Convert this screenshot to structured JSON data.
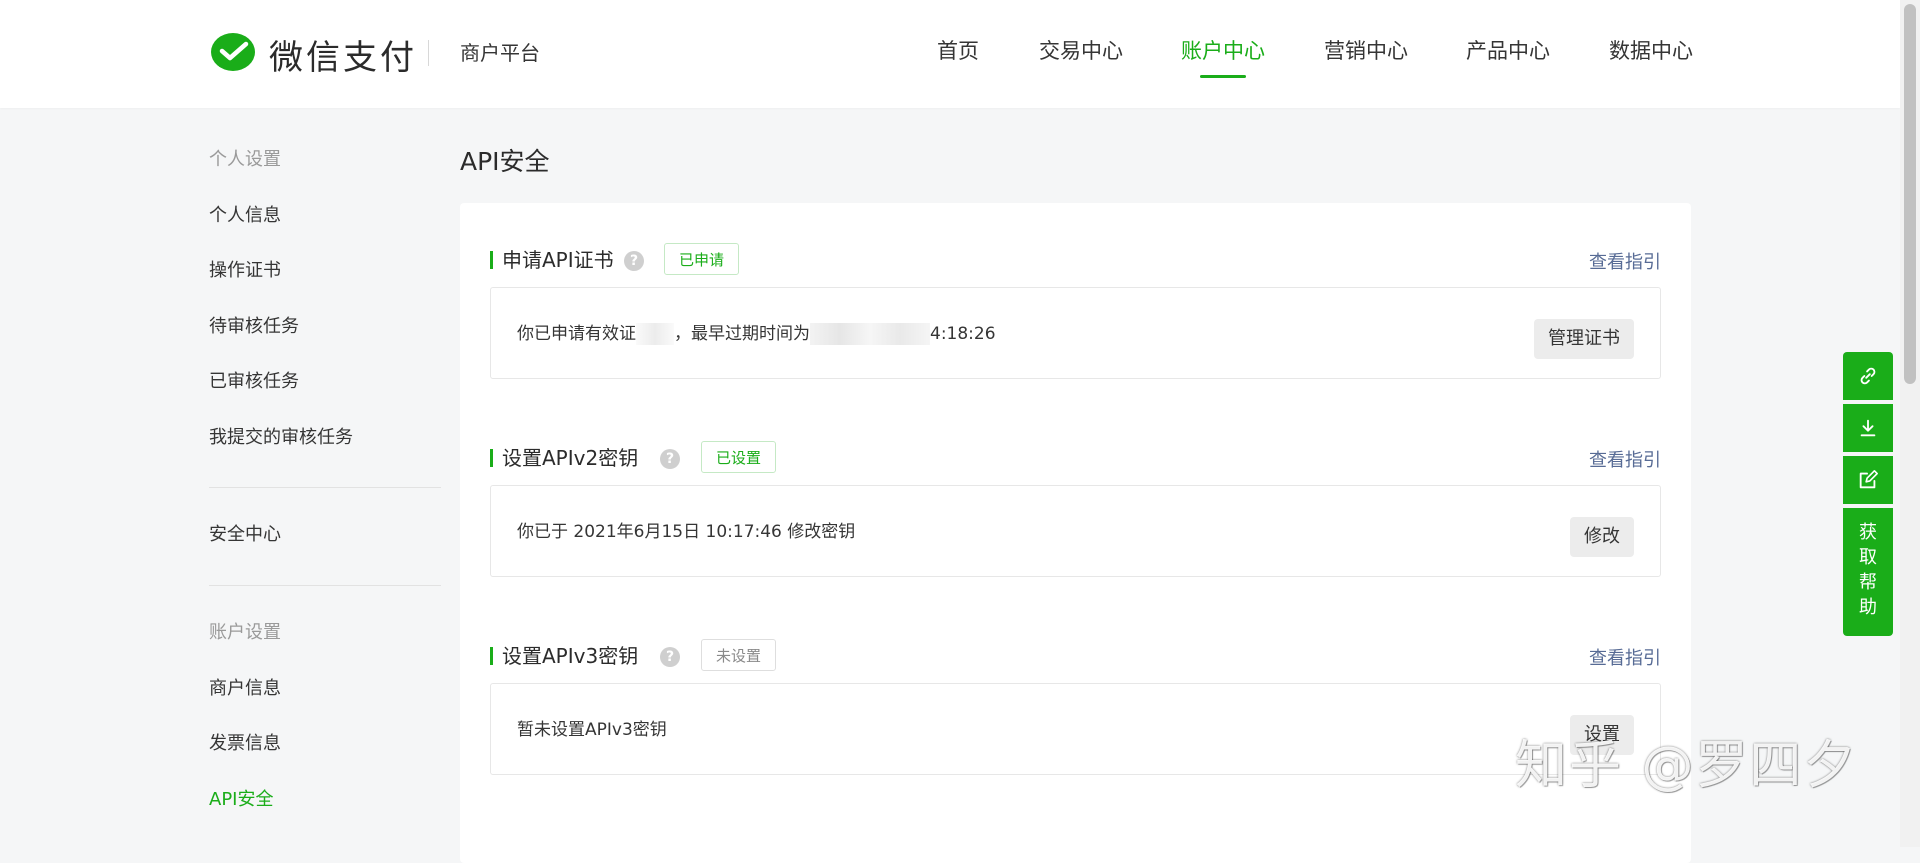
{
  "brand": {
    "name": "微信支付",
    "platform": "商户平台",
    "color": "#1aad19"
  },
  "nav": {
    "items": [
      "首页",
      "交易中心",
      "账户中心",
      "营销中心",
      "产品中心",
      "数据中心"
    ],
    "active": "账户中心"
  },
  "sidebar": {
    "personal_group": "个人设置",
    "personal_items": [
      "个人信息",
      "操作证书",
      "待审核任务",
      "已审核任务",
      "我提交的审核任务"
    ],
    "security_center": "安全中心",
    "account_group": "账户设置",
    "account_items": [
      "商户信息",
      "发票信息",
      "API安全"
    ],
    "active": "API安全"
  },
  "page": {
    "title": "API安全"
  },
  "sections": [
    {
      "title": "申请API证书",
      "badge": "已申请",
      "guide": "查看指引",
      "text_prefix": "你已申请有效证",
      "text_mid": "，最早过期时间为",
      "text_suffix": "4:18:26",
      "button": "管理证书"
    },
    {
      "title": "设置APIv2密钥",
      "badge": "已设置",
      "guide": "查看指引",
      "text": "你已于 2021年6月15日 10:17:46 修改密钥",
      "button": "修改"
    },
    {
      "title": "设置APIv3密钥",
      "badge": "未设置",
      "guide": "查看指引",
      "text": "暂未设置APIv3密钥",
      "button": "设置"
    }
  ],
  "float_toolbar": {
    "icons": [
      "link-icon",
      "download-icon",
      "edit-icon"
    ],
    "help_label": "获取帮助"
  },
  "watermark": "知乎 @罗四夕"
}
